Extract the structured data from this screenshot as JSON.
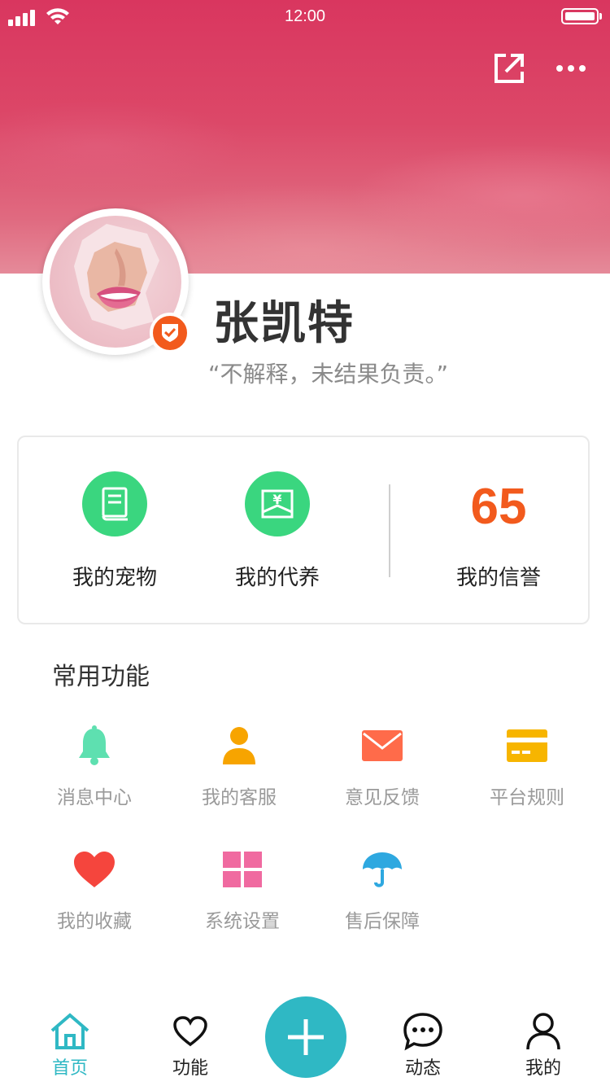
{
  "status_bar": {
    "time": "12:00"
  },
  "header": {
    "share_icon": "share-external-icon",
    "more_icon": "more-dots-icon"
  },
  "profile": {
    "name": "张凯特",
    "motto": "“不解释，未结果负责。”",
    "verified_badge_icon": "shield-check-icon"
  },
  "stats": {
    "pets_label": "我的宠物",
    "pets_icon": "book-icon",
    "fostering_label": "我的代养",
    "fostering_icon": "yen-ticket-icon",
    "credit_value": "65",
    "credit_label": "我的信誉"
  },
  "common_functions": {
    "title": "常用功能",
    "items": [
      {
        "label": "消息中心",
        "icon": "bell-icon",
        "color": "#5ee0b0"
      },
      {
        "label": "我的客服",
        "icon": "user-icon",
        "color": "#f7a400"
      },
      {
        "label": "意见反馈",
        "icon": "mail-icon",
        "color": "#ff6b4a"
      },
      {
        "label": "平台规则",
        "icon": "card-icon",
        "color": "#f7b500"
      },
      {
        "label": "我的收藏",
        "icon": "heart-icon",
        "color": "#f5453d"
      },
      {
        "label": "系统设置",
        "icon": "grid-icon",
        "color": "#f06aa0"
      },
      {
        "label": "售后保障",
        "icon": "umbrella-icon",
        "color": "#2ea8e0"
      }
    ]
  },
  "tabbar": {
    "home": "首页",
    "functions": "功能",
    "add_icon": "plus-icon",
    "activity": "动态",
    "mine": "我的"
  },
  "colors": {
    "accent": "#2fb8c4",
    "credit": "#f25a1d",
    "stat_icon_bg": "#3ad67f"
  }
}
